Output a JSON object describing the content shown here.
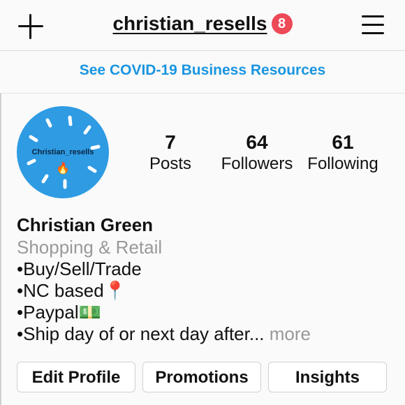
{
  "header": {
    "username": "christian_resells",
    "notification_count": "8",
    "icons": [
      "plus-icon",
      "menu-icon"
    ],
    "badge_color": "#ed4956"
  },
  "banner": {
    "covid_link": "See COVID-19 Business Resources",
    "link_color": "#1a95e0"
  },
  "profile": {
    "avatar_text": "Christian_resells",
    "avatar_emoji": "🔥",
    "avatar_color": "#2e9be3",
    "stats": [
      {
        "count": "7",
        "label": "Posts"
      },
      {
        "count": "64",
        "label": "Followers"
      },
      {
        "count": "61",
        "label": "Following"
      }
    ]
  },
  "bio": {
    "name": "Christian Green",
    "category": "Shopping & Retail",
    "lines": [
      "•Buy/Sell/Trade",
      "•NC based📍",
      "•Paypal💵",
      "•Ship day of or next day after..."
    ],
    "more_label": " more"
  },
  "actions": {
    "edit_profile": "Edit Profile",
    "promotions": "Promotions",
    "insights": "Insights"
  }
}
